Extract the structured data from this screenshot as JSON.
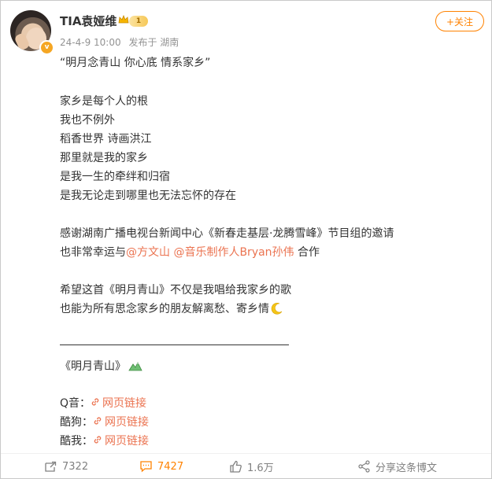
{
  "post": {
    "author": "TIA袁娅维",
    "level": "1",
    "time": "24-4-9 10:00",
    "source": "发布于 湖南",
    "follow_label": "+关注",
    "lines": {
      "l1": "“明月念青山 你心底 情系家乡”",
      "l2": "家乡是每个人的根",
      "l3": "我也不例外",
      "l4": "稻香世界 诗画洪江",
      "l5": "那里就是我的家乡",
      "l6": "是我一生的牵绊和归宿",
      "l7": "是我无论走到哪里也无法忘怀的存在",
      "l8": "感谢湖南广播电视台新闻中心《新春走基层·龙腾雪峰》节目组的邀请",
      "l9_prefix": "也非常幸运与",
      "mention1": "@方文山",
      "mention2": "@音乐制作人Bryan孙伟",
      "l9_suffix": " 合作",
      "l10": "希望这首《明月青山》不仅是我唱给我家乡的歌",
      "l11": "也能为所有思念家乡的朋友解离愁、寄乡情",
      "l12": "《明月青山》"
    },
    "links": [
      {
        "platform": "Q音：",
        "label": "网页链接"
      },
      {
        "platform": "酷狗：",
        "label": "网页链接"
      },
      {
        "platform": "酷我：",
        "label": "网页链接"
      }
    ]
  },
  "actions": {
    "repost": "7322",
    "comment": "7427",
    "like": "1.6万",
    "share": "分享这条博文"
  },
  "colors": {
    "accent": "#ff8200",
    "link": "#eb7350"
  }
}
